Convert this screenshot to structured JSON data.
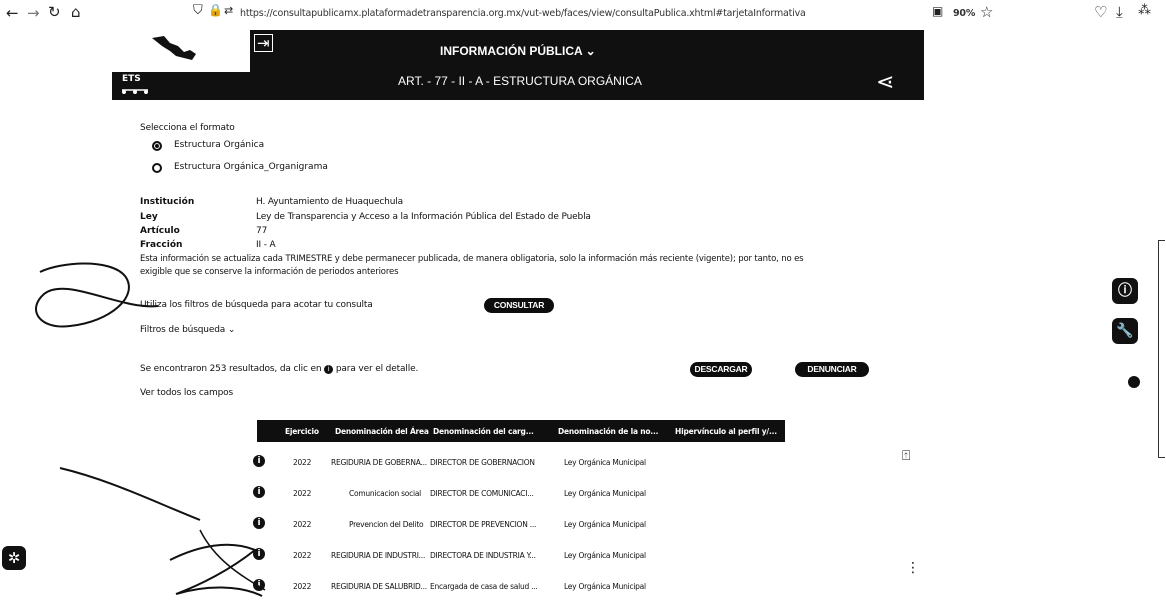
{
  "browser": {
    "url": "https://consultapublicamx.plataformadetransparencia.org.mx/vut-web/faces/view/consultaPublica.xhtml#tarjetaInformativa",
    "zoom": "90%"
  },
  "header": {
    "section_title": "INFORMACIÓN PÚBLICA",
    "subtitle": "ART. - 77 - II - A - ESTRUCTURA ORGÁNICA",
    "logo_text": "ETS"
  },
  "format": {
    "label": "Selecciona el formato",
    "options": [
      "Estructura Orgánica",
      "Estructura Orgánica_Organigrama"
    ],
    "selected": 0
  },
  "details": {
    "institucion_label": "Institución",
    "institucion_value": "H. Ayuntamiento de Huaquechula",
    "ley_label": "Ley",
    "ley_value": "Ley de Transparencia y Acceso a la Información Pública del Estado de Puebla",
    "articulo_label": "Artículo",
    "articulo_value": "77",
    "fraccion_label": "Fracción",
    "fraccion_value": "II - A",
    "notice_line1": "Esta información se actualiza cada TRIMESTRE y debe permanecer publicada, de manera obligatoria, solo la información más reciente (vigente); por tanto, no es",
    "notice_line2": "exigible que se conserve la información de periodos anteriores"
  },
  "search": {
    "hint": "Utiliza los filtros de búsqueda para acotar tu consulta",
    "consult_button": "CONSULTAR",
    "filters_label": "Filtros de búsqueda"
  },
  "results": {
    "summary_prefix": "Se encontraron 253 resultados, da clic en",
    "summary_suffix": "para ver el detalle.",
    "download_button": "DESCARGAR",
    "report_button": "DENUNCIAR",
    "view_all": "Ver todos los campos"
  },
  "table": {
    "columns": [
      "Ejercicio",
      "Denominación del Área",
      "Denominación del carg...",
      "Denominación de la no...",
      "Hipervínculo al perfil y/..."
    ],
    "rows": [
      [
        "2022",
        "REGIDURIA DE GOBERNA...",
        "DIRECTOR DE GOBERNACION",
        "Ley Orgánica Municipal"
      ],
      [
        "2022",
        "Comunicacion social",
        "DIRECTOR DE COMUNICACI...",
        "Ley Orgánica Municipal"
      ],
      [
        "2022",
        "Prevencion del Delito",
        "DIRECTOR DE PREVENCION ...",
        "Ley Orgánica Municipal"
      ],
      [
        "2022",
        "REGIDURIA DE INDUSTRI...",
        "DIRECTORA DE INDUSTRIA Y...",
        "Ley Orgánica Municipal"
      ],
      [
        "2022",
        "REGIDURIA DE SALUBRID...",
        "Encargada de casa de salud ...",
        "Ley Orgánica Municipal"
      ]
    ]
  }
}
